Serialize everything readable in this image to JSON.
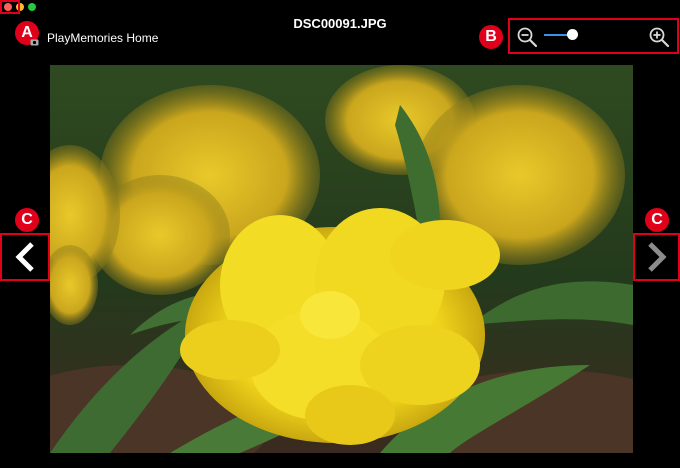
{
  "window": {
    "title": "DSC00091.JPG",
    "app_name": "PlayMemories Home"
  },
  "markers": {
    "a": "A",
    "b": "B",
    "c_left": "C",
    "c_right": "C"
  },
  "zoom": {
    "level": 0.6,
    "zoom_out_icon": "zoom-out-icon",
    "zoom_in_icon": "zoom-in-icon"
  },
  "navigation": {
    "previous_icon": "chevron-left-icon",
    "next_icon": "chevron-right-icon"
  },
  "colors": {
    "annotation_red": "#e0001a",
    "slider_blue": "#3f8ee8"
  }
}
